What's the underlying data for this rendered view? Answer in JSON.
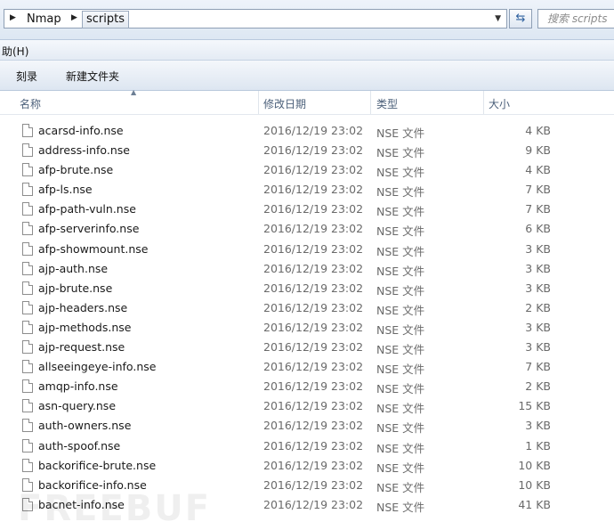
{
  "address_bar": {
    "crumbs": [
      "Nmap",
      "scripts"
    ]
  },
  "search": {
    "placeholder": "搜索 scripts"
  },
  "menu": {
    "help": "助(H)"
  },
  "toolbar": {
    "burn": "刻录",
    "new_folder": "新建文件夹"
  },
  "columns": {
    "name": "名称",
    "modified": "修改日期",
    "type": "类型",
    "size": "大小"
  },
  "files": [
    {
      "name": "acarsd-info.nse",
      "modified": "2016/12/19 23:02",
      "type": "NSE 文件",
      "size": "4 KB"
    },
    {
      "name": "address-info.nse",
      "modified": "2016/12/19 23:02",
      "type": "NSE 文件",
      "size": "9 KB"
    },
    {
      "name": "afp-brute.nse",
      "modified": "2016/12/19 23:02",
      "type": "NSE 文件",
      "size": "4 KB"
    },
    {
      "name": "afp-ls.nse",
      "modified": "2016/12/19 23:02",
      "type": "NSE 文件",
      "size": "7 KB"
    },
    {
      "name": "afp-path-vuln.nse",
      "modified": "2016/12/19 23:02",
      "type": "NSE 文件",
      "size": "7 KB"
    },
    {
      "name": "afp-serverinfo.nse",
      "modified": "2016/12/19 23:02",
      "type": "NSE 文件",
      "size": "6 KB"
    },
    {
      "name": "afp-showmount.nse",
      "modified": "2016/12/19 23:02",
      "type": "NSE 文件",
      "size": "3 KB"
    },
    {
      "name": "ajp-auth.nse",
      "modified": "2016/12/19 23:02",
      "type": "NSE 文件",
      "size": "3 KB"
    },
    {
      "name": "ajp-brute.nse",
      "modified": "2016/12/19 23:02",
      "type": "NSE 文件",
      "size": "3 KB"
    },
    {
      "name": "ajp-headers.nse",
      "modified": "2016/12/19 23:02",
      "type": "NSE 文件",
      "size": "2 KB"
    },
    {
      "name": "ajp-methods.nse",
      "modified": "2016/12/19 23:02",
      "type": "NSE 文件",
      "size": "3 KB"
    },
    {
      "name": "ajp-request.nse",
      "modified": "2016/12/19 23:02",
      "type": "NSE 文件",
      "size": "3 KB"
    },
    {
      "name": "allseeingeye-info.nse",
      "modified": "2016/12/19 23:02",
      "type": "NSE 文件",
      "size": "7 KB"
    },
    {
      "name": "amqp-info.nse",
      "modified": "2016/12/19 23:02",
      "type": "NSE 文件",
      "size": "2 KB"
    },
    {
      "name": "asn-query.nse",
      "modified": "2016/12/19 23:02",
      "type": "NSE 文件",
      "size": "15 KB"
    },
    {
      "name": "auth-owners.nse",
      "modified": "2016/12/19 23:02",
      "type": "NSE 文件",
      "size": "3 KB"
    },
    {
      "name": "auth-spoof.nse",
      "modified": "2016/12/19 23:02",
      "type": "NSE 文件",
      "size": "1 KB"
    },
    {
      "name": "backorifice-brute.nse",
      "modified": "2016/12/19 23:02",
      "type": "NSE 文件",
      "size": "10 KB"
    },
    {
      "name": "backorifice-info.nse",
      "modified": "2016/12/19 23:02",
      "type": "NSE 文件",
      "size": "10 KB"
    },
    {
      "name": "bacnet-info.nse",
      "modified": "2016/12/19 23:02",
      "type": "NSE 文件",
      "size": "41 KB"
    }
  ],
  "watermark": "FREEBUF"
}
